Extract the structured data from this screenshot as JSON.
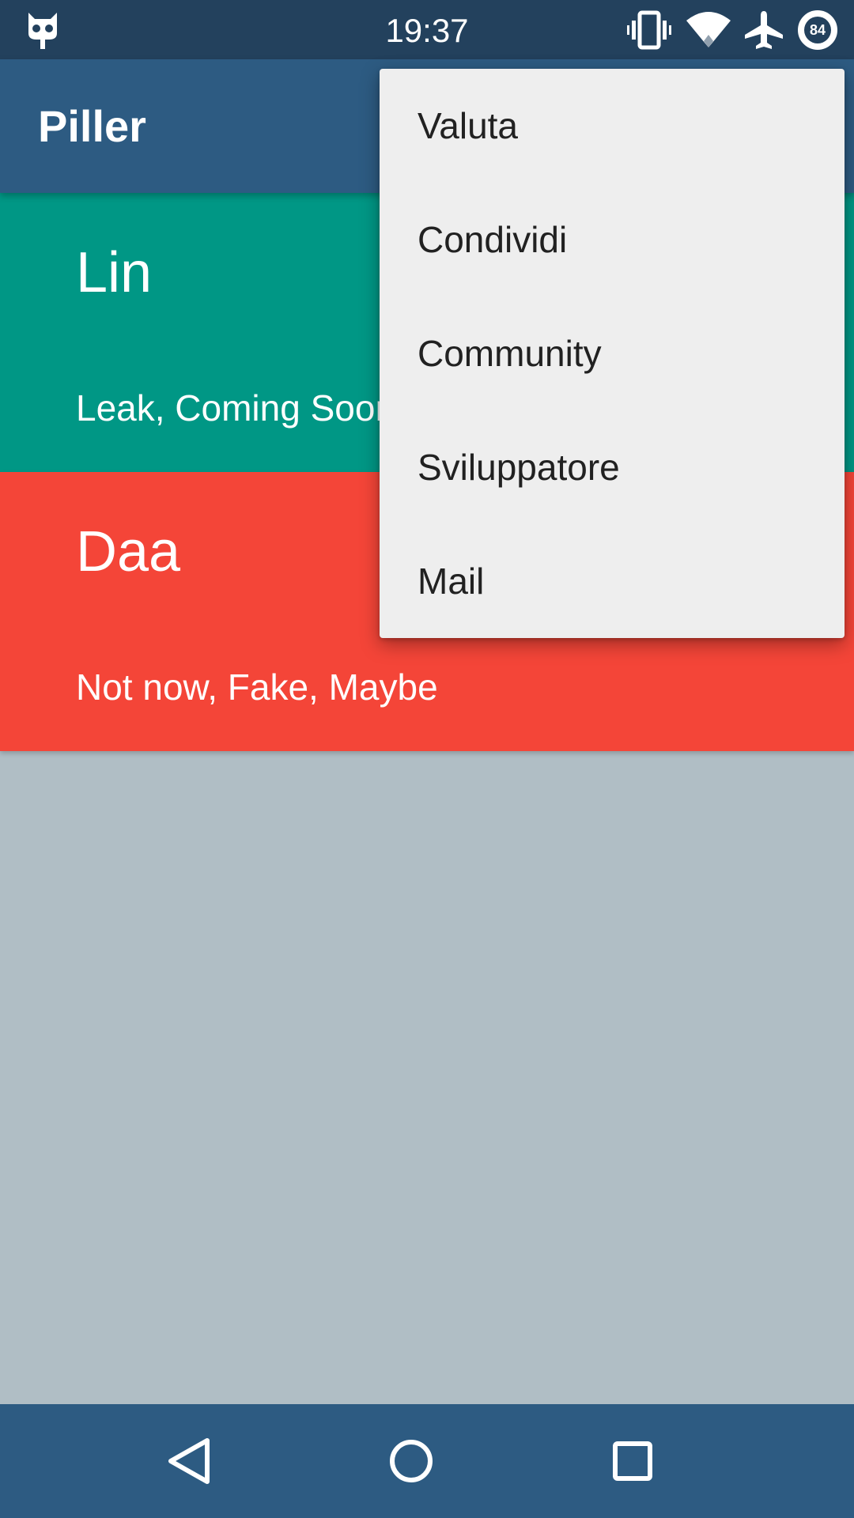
{
  "status_bar": {
    "time": "19:37",
    "battery_level": "84",
    "icons": [
      "cyanogen-mascot-icon",
      "vibrate-icon",
      "wifi-icon",
      "airplane-mode-icon",
      "battery-icon"
    ]
  },
  "app_bar": {
    "title": "Piller"
  },
  "cards": [
    {
      "title": "Lin",
      "subtitle": "Leak, Coming Soon",
      "color": "#009785"
    },
    {
      "title": "Daa",
      "subtitle": "Not now, Fake, Maybe",
      "color": "#f44538"
    }
  ],
  "overflow_menu": {
    "items": [
      {
        "label": "Valuta"
      },
      {
        "label": "Condividi"
      },
      {
        "label": "Community"
      },
      {
        "label": "Sviluppatore"
      },
      {
        "label": "Mail"
      }
    ]
  },
  "nav_bar": {
    "icons": [
      "back-icon",
      "home-icon",
      "recents-icon"
    ]
  },
  "colors": {
    "status_bar": "#23415d",
    "primary": "#2d5b82",
    "background": "#b0bec5",
    "menu_background": "#eeeeee"
  }
}
